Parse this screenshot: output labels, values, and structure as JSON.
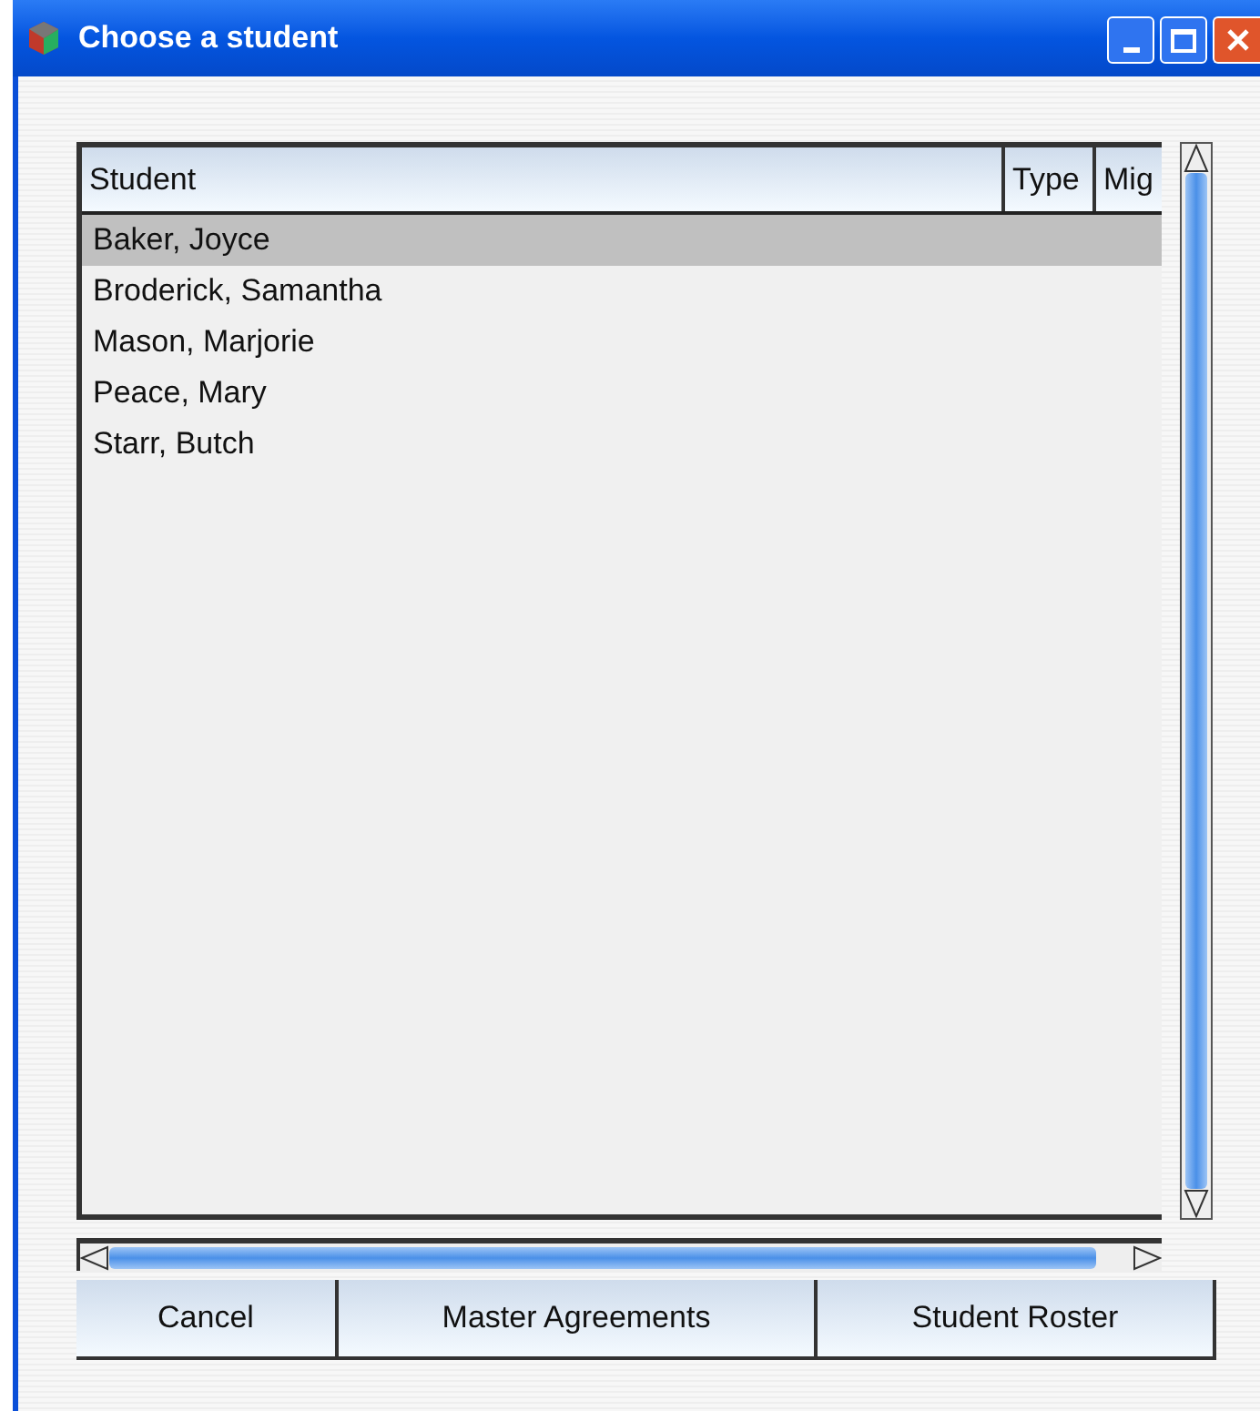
{
  "window": {
    "title": "Choose a student"
  },
  "table": {
    "columns": [
      {
        "label": "Student"
      },
      {
        "label": "Type"
      },
      {
        "label": "Mig"
      }
    ],
    "rows": [
      {
        "student": "Baker, Joyce",
        "selected": true
      },
      {
        "student": "Broderick, Samantha",
        "selected": false
      },
      {
        "student": "Mason, Marjorie",
        "selected": false
      },
      {
        "student": "Peace, Mary",
        "selected": false
      },
      {
        "student": "Starr, Butch",
        "selected": false
      }
    ]
  },
  "buttons": [
    {
      "label": "Cancel"
    },
    {
      "label": "Master Agreements"
    },
    {
      "label": "Student Roster"
    }
  ]
}
